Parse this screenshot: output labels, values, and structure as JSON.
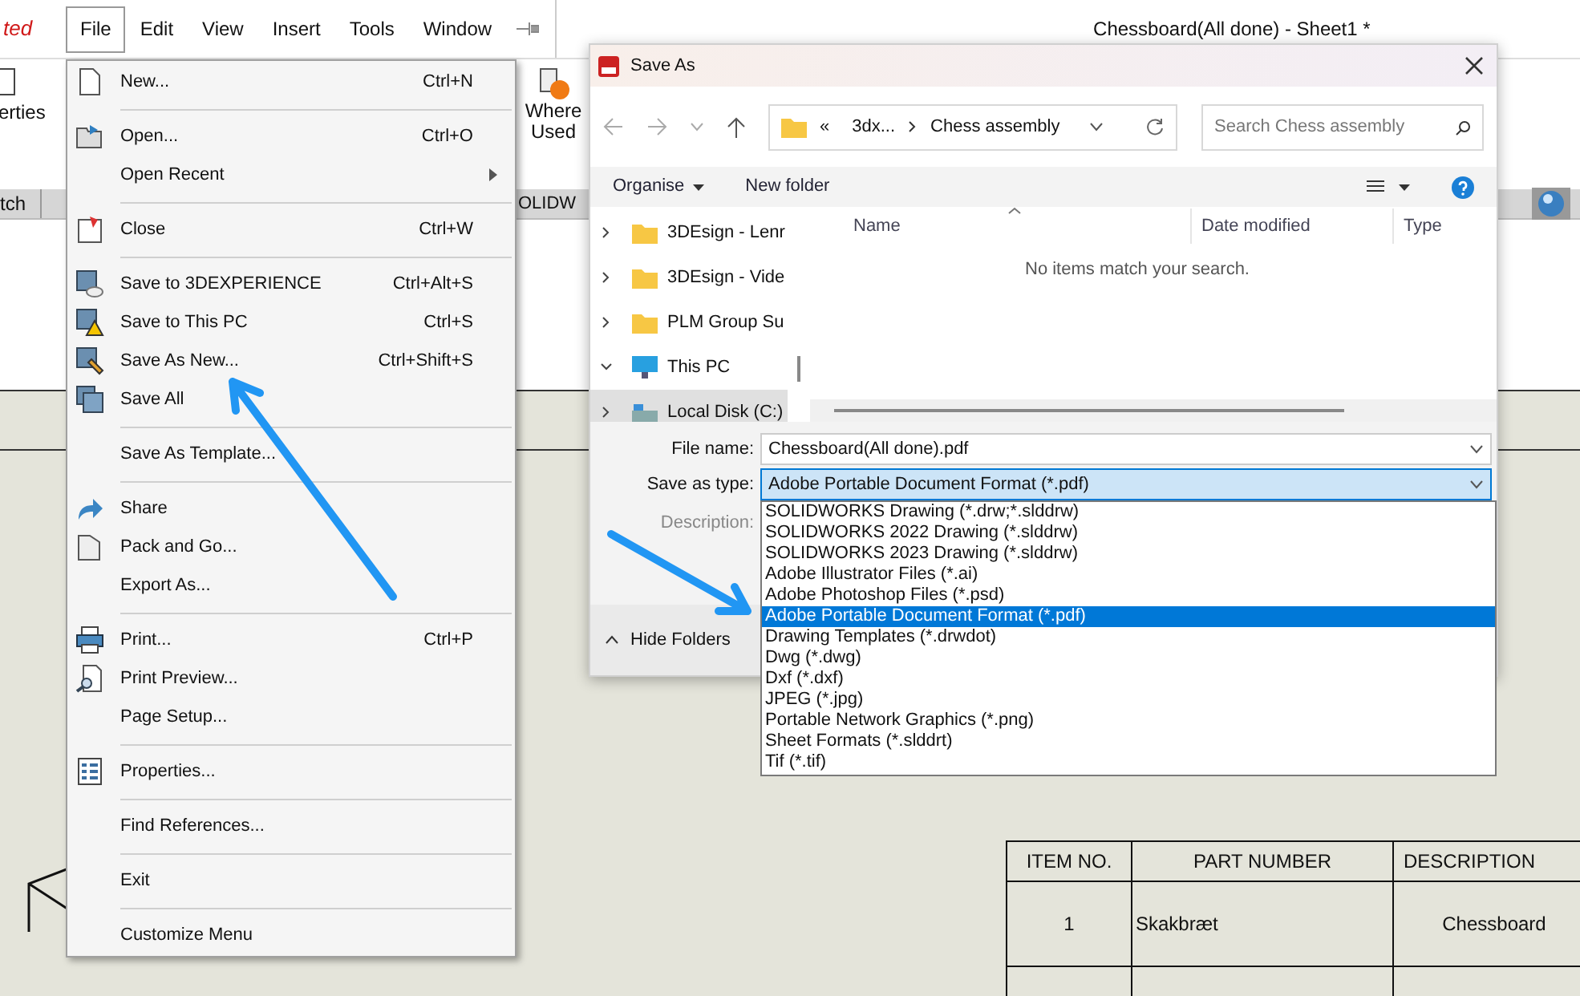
{
  "app": {
    "mode_label": "ted",
    "title": "Chessboard(All done) - Sheet1 *",
    "menubar": [
      {
        "label": "File",
        "selected": true
      },
      {
        "label": "Edit",
        "selected": false
      },
      {
        "label": "View",
        "selected": false
      },
      {
        "label": "Insert",
        "selected": false
      },
      {
        "label": "Tools",
        "selected": false
      },
      {
        "label": "Window",
        "selected": false
      }
    ],
    "toolbar": [
      "erties",
      "Where Used"
    ],
    "tabs": [
      "tch",
      "OLIDW"
    ]
  },
  "file_menu": {
    "items": [
      {
        "kind": "item",
        "label": "New...",
        "shortcut": "Ctrl+N"
      },
      {
        "kind": "separator"
      },
      {
        "kind": "item",
        "label": "Open...",
        "shortcut": "Ctrl+O"
      },
      {
        "kind": "submenu",
        "label": "Open Recent"
      },
      {
        "kind": "separator"
      },
      {
        "kind": "item",
        "label": "Close",
        "shortcut": "Ctrl+W"
      },
      {
        "kind": "separator"
      },
      {
        "kind": "item",
        "label": "Save to 3DEXPERIENCE",
        "shortcut": "Ctrl+Alt+S"
      },
      {
        "kind": "item",
        "label": "Save to This PC",
        "shortcut": "Ctrl+S"
      },
      {
        "kind": "item",
        "label": "Save As New...",
        "shortcut": "Ctrl+Shift+S"
      },
      {
        "kind": "item",
        "label": "Save All"
      },
      {
        "kind": "separator"
      },
      {
        "kind": "item",
        "label": "Save As Template..."
      },
      {
        "kind": "separator"
      },
      {
        "kind": "item",
        "label": "Share"
      },
      {
        "kind": "item",
        "label": "Pack and Go..."
      },
      {
        "kind": "item",
        "label": "Export As..."
      },
      {
        "kind": "separator"
      },
      {
        "kind": "item",
        "label": "Print...",
        "shortcut": "Ctrl+P"
      },
      {
        "kind": "item",
        "label": "Print Preview..."
      },
      {
        "kind": "item",
        "label": "Page Setup..."
      },
      {
        "kind": "separator"
      },
      {
        "kind": "item",
        "label": "Properties..."
      },
      {
        "kind": "separator"
      },
      {
        "kind": "item",
        "label": "Find References..."
      },
      {
        "kind": "separator"
      },
      {
        "kind": "item",
        "label": "Exit"
      },
      {
        "kind": "separator"
      },
      {
        "kind": "item",
        "label": "Customize Menu"
      }
    ]
  },
  "save_dialog": {
    "title": "Save As",
    "breadcrumb": [
      "«",
      "3dx...",
      "Chess assembly"
    ],
    "search": {
      "placeholder": "Search Chess assembly"
    },
    "toolbar": [
      "Organise",
      "New folder"
    ],
    "tree": [
      {
        "label": "3DEsign - Lenr",
        "expanded": false,
        "selected": false
      },
      {
        "label": "3DEsign - Vide",
        "expanded": false,
        "selected": false
      },
      {
        "label": "PLM Group Su",
        "expanded": false,
        "selected": false
      },
      {
        "label": "This PC",
        "expanded": true,
        "selected": false,
        "children": [
          {
            "label": "Local Disk (C:)",
            "expanded": false,
            "selected": true
          }
        ]
      }
    ],
    "columns": [
      "Name",
      "Date modified",
      "Type"
    ],
    "empty_message": "No items match your search.",
    "file_name": {
      "label": "File name:",
      "value": "Chessboard(All done).pdf"
    },
    "save_as_type": {
      "label": "Save as type:",
      "value": "Adobe Portable Document Format (*.pdf)",
      "options": [
        {
          "label": "SOLIDWORKS Drawing (*.drw;*.slddrw)",
          "selected": false
        },
        {
          "label": "SOLIDWORKS 2022 Drawing (*.slddrw)",
          "selected": false
        },
        {
          "label": "SOLIDWORKS 2023 Drawing (*.slddrw)",
          "selected": false
        },
        {
          "label": "Adobe Illustrator Files (*.ai)",
          "selected": false
        },
        {
          "label": "Adobe Photoshop Files (*.psd)",
          "selected": false
        },
        {
          "label": "Adobe Portable Document Format (*.pdf)",
          "selected": true
        },
        {
          "label": "Drawing Templates (*.drwdot)",
          "selected": false
        },
        {
          "label": "Dwg (*.dwg)",
          "selected": false
        },
        {
          "label": "Dxf (*.dxf)",
          "selected": false
        },
        {
          "label": "JPEG (*.jpg)",
          "selected": false
        },
        {
          "label": "Portable Network Graphics (*.png)",
          "selected": false
        },
        {
          "label": "Sheet Formats (*.slddrt)",
          "selected": false
        },
        {
          "label": "Tif (*.tif)",
          "selected": false
        }
      ]
    },
    "description_label": "Description:",
    "hide_folders": "Hide Folders"
  },
  "bom_table": {
    "columns": [
      "ITEM NO.",
      "PART NUMBER",
      "DESCRIPTION"
    ],
    "rows": [
      [
        "1",
        "Skakbræt",
        "Chessboard"
      ]
    ]
  }
}
